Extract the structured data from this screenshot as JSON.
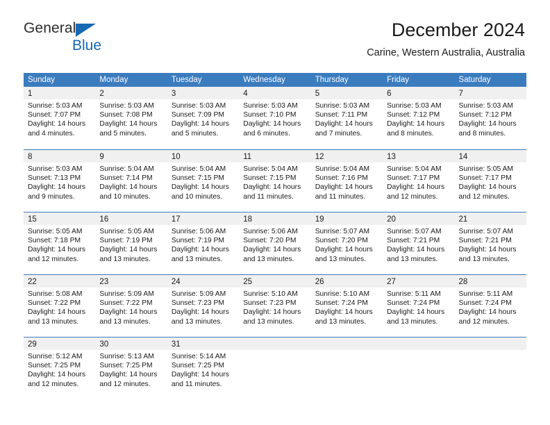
{
  "logo": {
    "text_top": "General",
    "text_bottom": "Blue",
    "triangle_icon": "blue-triangle-icon",
    "accent_color": "#1668b3"
  },
  "header": {
    "title": "December 2024",
    "subtitle": "Carine, Western Australia, Australia"
  },
  "theme": {
    "header_blue": "#3b7cbf",
    "day_band_gray": "#f0f0f0",
    "text_color": "#1a1a1a"
  },
  "weekday_headers": [
    "Sunday",
    "Monday",
    "Tuesday",
    "Wednesday",
    "Thursday",
    "Friday",
    "Saturday"
  ],
  "weeks": [
    [
      {
        "day": "1",
        "sunrise": "Sunrise: 5:03 AM",
        "sunset": "Sunset: 7:07 PM",
        "daylight_1": "Daylight: 14 hours",
        "daylight_2": "and 4 minutes."
      },
      {
        "day": "2",
        "sunrise": "Sunrise: 5:03 AM",
        "sunset": "Sunset: 7:08 PM",
        "daylight_1": "Daylight: 14 hours",
        "daylight_2": "and 5 minutes."
      },
      {
        "day": "3",
        "sunrise": "Sunrise: 5:03 AM",
        "sunset": "Sunset: 7:09 PM",
        "daylight_1": "Daylight: 14 hours",
        "daylight_2": "and 5 minutes."
      },
      {
        "day": "4",
        "sunrise": "Sunrise: 5:03 AM",
        "sunset": "Sunset: 7:10 PM",
        "daylight_1": "Daylight: 14 hours",
        "daylight_2": "and 6 minutes."
      },
      {
        "day": "5",
        "sunrise": "Sunrise: 5:03 AM",
        "sunset": "Sunset: 7:11 PM",
        "daylight_1": "Daylight: 14 hours",
        "daylight_2": "and 7 minutes."
      },
      {
        "day": "6",
        "sunrise": "Sunrise: 5:03 AM",
        "sunset": "Sunset: 7:12 PM",
        "daylight_1": "Daylight: 14 hours",
        "daylight_2": "and 8 minutes."
      },
      {
        "day": "7",
        "sunrise": "Sunrise: 5:03 AM",
        "sunset": "Sunset: 7:12 PM",
        "daylight_1": "Daylight: 14 hours",
        "daylight_2": "and 8 minutes."
      }
    ],
    [
      {
        "day": "8",
        "sunrise": "Sunrise: 5:03 AM",
        "sunset": "Sunset: 7:13 PM",
        "daylight_1": "Daylight: 14 hours",
        "daylight_2": "and 9 minutes."
      },
      {
        "day": "9",
        "sunrise": "Sunrise: 5:04 AM",
        "sunset": "Sunset: 7:14 PM",
        "daylight_1": "Daylight: 14 hours",
        "daylight_2": "and 10 minutes."
      },
      {
        "day": "10",
        "sunrise": "Sunrise: 5:04 AM",
        "sunset": "Sunset: 7:15 PM",
        "daylight_1": "Daylight: 14 hours",
        "daylight_2": "and 10 minutes."
      },
      {
        "day": "11",
        "sunrise": "Sunrise: 5:04 AM",
        "sunset": "Sunset: 7:15 PM",
        "daylight_1": "Daylight: 14 hours",
        "daylight_2": "and 11 minutes."
      },
      {
        "day": "12",
        "sunrise": "Sunrise: 5:04 AM",
        "sunset": "Sunset: 7:16 PM",
        "daylight_1": "Daylight: 14 hours",
        "daylight_2": "and 11 minutes."
      },
      {
        "day": "13",
        "sunrise": "Sunrise: 5:04 AM",
        "sunset": "Sunset: 7:17 PM",
        "daylight_1": "Daylight: 14 hours",
        "daylight_2": "and 12 minutes."
      },
      {
        "day": "14",
        "sunrise": "Sunrise: 5:05 AM",
        "sunset": "Sunset: 7:17 PM",
        "daylight_1": "Daylight: 14 hours",
        "daylight_2": "and 12 minutes."
      }
    ],
    [
      {
        "day": "15",
        "sunrise": "Sunrise: 5:05 AM",
        "sunset": "Sunset: 7:18 PM",
        "daylight_1": "Daylight: 14 hours",
        "daylight_2": "and 12 minutes."
      },
      {
        "day": "16",
        "sunrise": "Sunrise: 5:05 AM",
        "sunset": "Sunset: 7:19 PM",
        "daylight_1": "Daylight: 14 hours",
        "daylight_2": "and 13 minutes."
      },
      {
        "day": "17",
        "sunrise": "Sunrise: 5:06 AM",
        "sunset": "Sunset: 7:19 PM",
        "daylight_1": "Daylight: 14 hours",
        "daylight_2": "and 13 minutes."
      },
      {
        "day": "18",
        "sunrise": "Sunrise: 5:06 AM",
        "sunset": "Sunset: 7:20 PM",
        "daylight_1": "Daylight: 14 hours",
        "daylight_2": "and 13 minutes."
      },
      {
        "day": "19",
        "sunrise": "Sunrise: 5:07 AM",
        "sunset": "Sunset: 7:20 PM",
        "daylight_1": "Daylight: 14 hours",
        "daylight_2": "and 13 minutes."
      },
      {
        "day": "20",
        "sunrise": "Sunrise: 5:07 AM",
        "sunset": "Sunset: 7:21 PM",
        "daylight_1": "Daylight: 14 hours",
        "daylight_2": "and 13 minutes."
      },
      {
        "day": "21",
        "sunrise": "Sunrise: 5:07 AM",
        "sunset": "Sunset: 7:21 PM",
        "daylight_1": "Daylight: 14 hours",
        "daylight_2": "and 13 minutes."
      }
    ],
    [
      {
        "day": "22",
        "sunrise": "Sunrise: 5:08 AM",
        "sunset": "Sunset: 7:22 PM",
        "daylight_1": "Daylight: 14 hours",
        "daylight_2": "and 13 minutes."
      },
      {
        "day": "23",
        "sunrise": "Sunrise: 5:09 AM",
        "sunset": "Sunset: 7:22 PM",
        "daylight_1": "Daylight: 14 hours",
        "daylight_2": "and 13 minutes."
      },
      {
        "day": "24",
        "sunrise": "Sunrise: 5:09 AM",
        "sunset": "Sunset: 7:23 PM",
        "daylight_1": "Daylight: 14 hours",
        "daylight_2": "and 13 minutes."
      },
      {
        "day": "25",
        "sunrise": "Sunrise: 5:10 AM",
        "sunset": "Sunset: 7:23 PM",
        "daylight_1": "Daylight: 14 hours",
        "daylight_2": "and 13 minutes."
      },
      {
        "day": "26",
        "sunrise": "Sunrise: 5:10 AM",
        "sunset": "Sunset: 7:24 PM",
        "daylight_1": "Daylight: 14 hours",
        "daylight_2": "and 13 minutes."
      },
      {
        "day": "27",
        "sunrise": "Sunrise: 5:11 AM",
        "sunset": "Sunset: 7:24 PM",
        "daylight_1": "Daylight: 14 hours",
        "daylight_2": "and 13 minutes."
      },
      {
        "day": "28",
        "sunrise": "Sunrise: 5:11 AM",
        "sunset": "Sunset: 7:24 PM",
        "daylight_1": "Daylight: 14 hours",
        "daylight_2": "and 12 minutes."
      }
    ],
    [
      {
        "day": "29",
        "sunrise": "Sunrise: 5:12 AM",
        "sunset": "Sunset: 7:25 PM",
        "daylight_1": "Daylight: 14 hours",
        "daylight_2": "and 12 minutes."
      },
      {
        "day": "30",
        "sunrise": "Sunrise: 5:13 AM",
        "sunset": "Sunset: 7:25 PM",
        "daylight_1": "Daylight: 14 hours",
        "daylight_2": "and 12 minutes."
      },
      {
        "day": "31",
        "sunrise": "Sunrise: 5:14 AM",
        "sunset": "Sunset: 7:25 PM",
        "daylight_1": "Daylight: 14 hours",
        "daylight_2": "and 11 minutes."
      },
      {
        "day": "",
        "sunrise": "",
        "sunset": "",
        "daylight_1": "",
        "daylight_2": ""
      },
      {
        "day": "",
        "sunrise": "",
        "sunset": "",
        "daylight_1": "",
        "daylight_2": ""
      },
      {
        "day": "",
        "sunrise": "",
        "sunset": "",
        "daylight_1": "",
        "daylight_2": ""
      },
      {
        "day": "",
        "sunrise": "",
        "sunset": "",
        "daylight_1": "",
        "daylight_2": ""
      }
    ]
  ]
}
